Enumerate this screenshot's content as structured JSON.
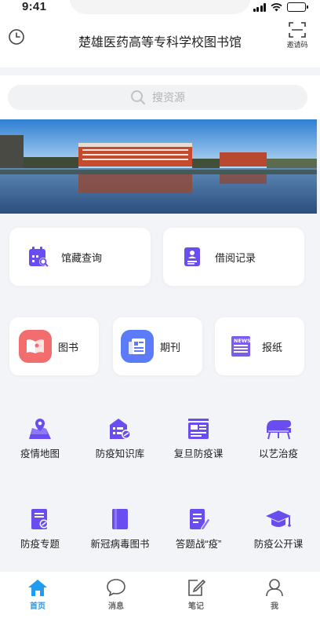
{
  "status_bar": {
    "time": "9:41"
  },
  "header": {
    "title": "楚雄医药高等专科学校图书馆",
    "scan_label": "邀请码"
  },
  "search": {
    "placeholder": "搜资源"
  },
  "quick_cards": [
    {
      "label": "馆藏查询",
      "icon": "calendar-search-icon"
    },
    {
      "label": "借阅记录",
      "icon": "record-icon"
    }
  ],
  "resource_cards": [
    {
      "label": "图书",
      "icon": "book-icon",
      "color": "#f26d6d"
    },
    {
      "label": "期刊",
      "icon": "journal-icon",
      "color": "#5b7bfb"
    },
    {
      "label": "报纸",
      "icon": "newspaper-icon",
      "color": "#7b5cf0"
    }
  ],
  "feature_row_1": [
    {
      "label": "疫情地图",
      "icon": "map-icon"
    },
    {
      "label": "防疫知识库",
      "icon": "knowledge-icon"
    },
    {
      "label": "复旦防疫课",
      "icon": "course-icon"
    },
    {
      "label": "以艺治疫",
      "icon": "piano-icon"
    }
  ],
  "feature_row_2": [
    {
      "label": "防疫专题",
      "icon": "topic-icon"
    },
    {
      "label": "新冠病毒图书",
      "icon": "books-icon"
    },
    {
      "label": "答题战“疫”",
      "icon": "quiz-icon"
    },
    {
      "label": "防疫公开课",
      "icon": "graduation-cap-icon"
    }
  ],
  "tabbar": [
    {
      "label": "首页",
      "icon": "home-icon",
      "active": true
    },
    {
      "label": "消息",
      "icon": "message-icon",
      "active": false
    },
    {
      "label": "笔记",
      "icon": "note-icon",
      "active": false
    },
    {
      "label": "我",
      "icon": "user-icon",
      "active": false
    }
  ],
  "colors": {
    "accent": "#1f9bf0",
    "purple": "#6a4df0",
    "background": "#f3f4f7"
  }
}
